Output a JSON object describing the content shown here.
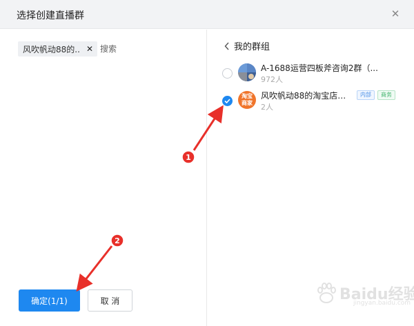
{
  "dialog": {
    "title": "选择创建直播群",
    "close_symbol": "✕"
  },
  "left": {
    "selected_chip": {
      "label": "风吹帆动88的...",
      "remove_symbol": "✕"
    },
    "search": {
      "placeholder": "搜索",
      "value": ""
    },
    "confirm_label": "确定(1/1)",
    "cancel_label": "取 消"
  },
  "right": {
    "back_label": "我的群组",
    "groups": [
      {
        "name": "A-1688运营四板斧咨询2群（...",
        "count": "972人",
        "checked": false,
        "avatar_text": ""
      },
      {
        "name": "风吹帆动88的淘宝店铺...",
        "count": "2人",
        "checked": true,
        "avatar_text": "淘宝\n商家",
        "tags": [
          "内部",
          "商务"
        ]
      }
    ]
  },
  "annotations": {
    "marker_1": "1",
    "marker_2": "2",
    "color": "#e8302a"
  },
  "watermark": {
    "brand": "Baidu经验",
    "url": "jingyan.baidu.com"
  },
  "colors": {
    "accent": "#1e88f0",
    "header_bg": "#f2f3f5"
  }
}
